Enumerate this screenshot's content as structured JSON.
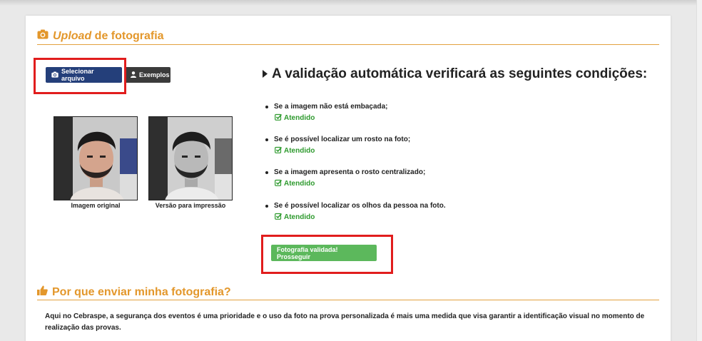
{
  "upload_section": {
    "title_italic": "Upload",
    "title_rest": " de fotografia",
    "select_button_label": "Selecionar arquivo",
    "examples_button_label": "Exemplos",
    "photos": [
      {
        "caption": "Imagem original"
      },
      {
        "caption": "Versão para impressão"
      }
    ]
  },
  "validation": {
    "heading": "A validação automática verificará as seguintes condições:",
    "conditions": [
      {
        "text": "Se a imagem não está embaçada;",
        "status": "Atendido"
      },
      {
        "text": "Se é possível localizar um rosto na foto;",
        "status": "Atendido"
      },
      {
        "text": "Se a imagem apresenta o rosto centralizado;",
        "status": "Atendido"
      },
      {
        "text": "Se é possível localizar os olhos da pessoa na foto.",
        "status": "Atendido"
      }
    ],
    "proceed_button_label": "Fotografia validada! Prosseguir"
  },
  "why_section": {
    "title": "Por que enviar minha fotografia?",
    "paragraph": "Aqui no Cebraspe, a segurança dos eventos é uma prioridade e o uso da foto na prova personalizada é mais uma medida que visa garantir a identificação visual no momento de realização das provas."
  },
  "colors": {
    "accent": "#e3972b",
    "primary": "#243f7a",
    "success": "#5cb85c",
    "ok_text": "#2e9a2e",
    "highlight": "#e11d1d"
  },
  "icons": {
    "upload_title": "camera-icon",
    "select_button": "camera-icon",
    "examples_button": "user-icon",
    "heading": "caret-right-icon",
    "status": "check-square-icon",
    "why_title": "thumbs-up-icon"
  }
}
